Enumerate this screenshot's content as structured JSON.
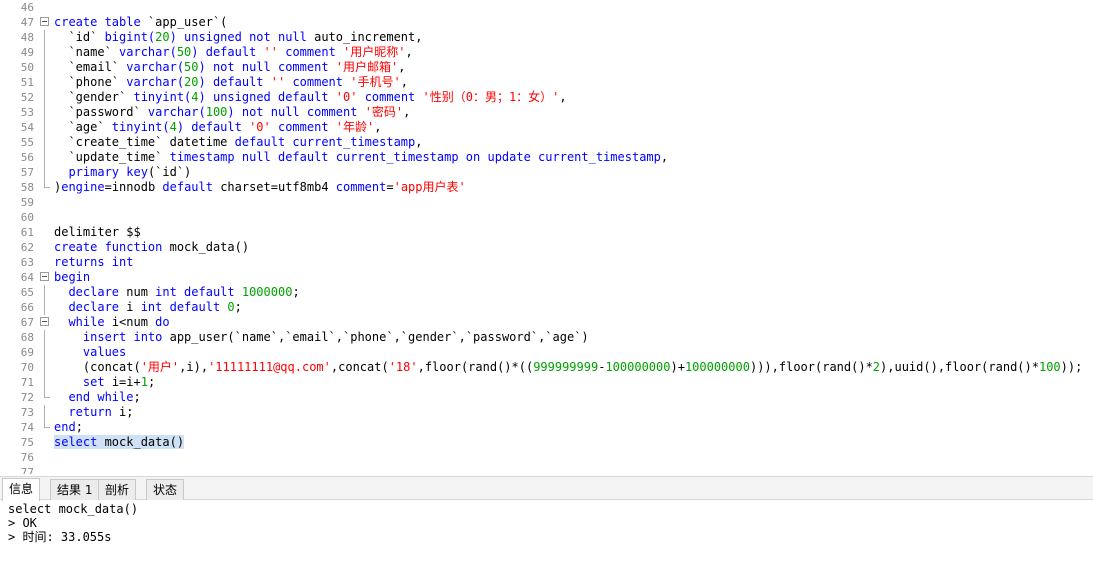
{
  "editor": {
    "lines": [
      {
        "n": "46",
        "segs": []
      },
      {
        "n": "47",
        "fold": "start",
        "segs": [
          [
            "kw",
            "create table "
          ],
          [
            "plain",
            "`app_user`("
          ]
        ]
      },
      {
        "n": "48",
        "fold": "line",
        "segs": [
          [
            "plain",
            "  `id` "
          ],
          [
            "kw",
            "bigint("
          ],
          [
            "num",
            "20"
          ],
          [
            "kw",
            ") unsigned not null "
          ],
          [
            "plain",
            "auto_increment,"
          ]
        ]
      },
      {
        "n": "49",
        "fold": "line",
        "segs": [
          [
            "plain",
            "  `name` "
          ],
          [
            "kw",
            "varchar("
          ],
          [
            "num",
            "50"
          ],
          [
            "kw",
            ") default "
          ],
          [
            "str",
            "'' "
          ],
          [
            "kw",
            "comment "
          ],
          [
            "str",
            "'用户昵称'"
          ],
          [
            "plain",
            ","
          ]
        ]
      },
      {
        "n": "50",
        "fold": "line",
        "segs": [
          [
            "plain",
            "  `email` "
          ],
          [
            "kw",
            "varchar("
          ],
          [
            "num",
            "50"
          ],
          [
            "kw",
            ") not null comment "
          ],
          [
            "str",
            "'用户邮箱'"
          ],
          [
            "plain",
            ","
          ]
        ]
      },
      {
        "n": "51",
        "fold": "line",
        "segs": [
          [
            "plain",
            "  `phone` "
          ],
          [
            "kw",
            "varchar("
          ],
          [
            "num",
            "20"
          ],
          [
            "kw",
            ") default "
          ],
          [
            "str",
            "'' "
          ],
          [
            "kw",
            "comment "
          ],
          [
            "str",
            "'手机号'"
          ],
          [
            "plain",
            ","
          ]
        ]
      },
      {
        "n": "52",
        "fold": "line",
        "segs": [
          [
            "plain",
            "  `gender` "
          ],
          [
            "kw",
            "tinyint("
          ],
          [
            "num",
            "4"
          ],
          [
            "kw",
            ") unsigned default "
          ],
          [
            "str",
            "'0' "
          ],
          [
            "kw",
            "comment "
          ],
          [
            "str",
            "'性别（0：男；1：女）'"
          ],
          [
            "plain",
            ","
          ]
        ]
      },
      {
        "n": "53",
        "fold": "line",
        "segs": [
          [
            "plain",
            "  `password` "
          ],
          [
            "kw",
            "varchar("
          ],
          [
            "num",
            "100"
          ],
          [
            "kw",
            ") not null comment "
          ],
          [
            "str",
            "'密码'"
          ],
          [
            "plain",
            ","
          ]
        ]
      },
      {
        "n": "54",
        "fold": "line",
        "segs": [
          [
            "plain",
            "  `age` "
          ],
          [
            "kw",
            "tinyint("
          ],
          [
            "num",
            "4"
          ],
          [
            "kw",
            ") default "
          ],
          [
            "str",
            "'0' "
          ],
          [
            "kw",
            "comment "
          ],
          [
            "str",
            "'年龄'"
          ],
          [
            "plain",
            ","
          ]
        ]
      },
      {
        "n": "55",
        "fold": "line",
        "segs": [
          [
            "plain",
            "  `create_time` datetime "
          ],
          [
            "kw",
            "default current_timestamp"
          ],
          [
            "plain",
            ","
          ]
        ]
      },
      {
        "n": "56",
        "fold": "line",
        "segs": [
          [
            "plain",
            "  `update_time` "
          ],
          [
            "kw",
            "timestamp null default current_timestamp on update current_timestamp"
          ],
          [
            "plain",
            ","
          ]
        ]
      },
      {
        "n": "57",
        "fold": "line",
        "segs": [
          [
            "plain",
            "  "
          ],
          [
            "kw",
            "primary key"
          ],
          [
            "plain",
            "(`id`)"
          ]
        ]
      },
      {
        "n": "58",
        "fold": "end",
        "segs": [
          [
            "plain",
            ")"
          ],
          [
            "kw",
            "engine"
          ],
          [
            "plain",
            "=innodb "
          ],
          [
            "kw",
            "default "
          ],
          [
            "plain",
            "charset=utf8mb4 "
          ],
          [
            "kw",
            "comment"
          ],
          [
            "plain",
            "="
          ],
          [
            "str",
            "'app用户表'"
          ]
        ]
      },
      {
        "n": "59",
        "segs": []
      },
      {
        "n": "60",
        "segs": []
      },
      {
        "n": "61",
        "segs": [
          [
            "plain",
            "delimiter $$"
          ]
        ]
      },
      {
        "n": "62",
        "segs": [
          [
            "kw",
            "create function "
          ],
          [
            "plain",
            "mock_data()"
          ]
        ]
      },
      {
        "n": "63",
        "segs": [
          [
            "kw",
            "returns int"
          ]
        ]
      },
      {
        "n": "64",
        "fold": "start",
        "segs": [
          [
            "kw",
            "begin"
          ]
        ]
      },
      {
        "n": "65",
        "fold": "line",
        "segs": [
          [
            "plain",
            "  "
          ],
          [
            "kw",
            "declare "
          ],
          [
            "plain",
            "num "
          ],
          [
            "kw",
            "int default "
          ],
          [
            "num",
            "1000000"
          ],
          [
            "plain",
            ";"
          ]
        ]
      },
      {
        "n": "66",
        "fold": "line",
        "segs": [
          [
            "plain",
            "  "
          ],
          [
            "kw",
            "declare "
          ],
          [
            "plain",
            "i "
          ],
          [
            "kw",
            "int default "
          ],
          [
            "num",
            "0"
          ],
          [
            "plain",
            ";"
          ]
        ]
      },
      {
        "n": "67",
        "fold": "start",
        "segs": [
          [
            "plain",
            "  "
          ],
          [
            "kw",
            "while "
          ],
          [
            "plain",
            "i<num "
          ],
          [
            "kw",
            "do"
          ]
        ]
      },
      {
        "n": "68",
        "fold": "line",
        "segs": [
          [
            "plain",
            "    "
          ],
          [
            "kw",
            "insert into "
          ],
          [
            "plain",
            "app_user(`name`,`email`,`phone`,`gender`,`password`,`age`)"
          ]
        ]
      },
      {
        "n": "69",
        "fold": "line",
        "segs": [
          [
            "plain",
            "    "
          ],
          [
            "kw",
            "values"
          ]
        ]
      },
      {
        "n": "70",
        "fold": "line",
        "segs": [
          [
            "plain",
            "    (concat("
          ],
          [
            "str",
            "'用户'"
          ],
          [
            "plain",
            ",i),"
          ],
          [
            "str",
            "'11111111@qq.com'"
          ],
          [
            "plain",
            ",concat("
          ],
          [
            "str",
            "'18'"
          ],
          [
            "plain",
            ",floor(rand()*(("
          ],
          [
            "num",
            "999999999"
          ],
          [
            "plain",
            "-"
          ],
          [
            "num",
            "100000000"
          ],
          [
            "plain",
            ")+"
          ],
          [
            "num",
            "100000000"
          ],
          [
            "plain",
            "))),floor(rand()*"
          ],
          [
            "num",
            "2"
          ],
          [
            "plain",
            "),uuid(),floor(rand()*"
          ],
          [
            "num",
            "100"
          ],
          [
            "plain",
            "));"
          ]
        ]
      },
      {
        "n": "71",
        "fold": "line",
        "segs": [
          [
            "plain",
            "    "
          ],
          [
            "kw",
            "set "
          ],
          [
            "plain",
            "i=i+"
          ],
          [
            "num",
            "1"
          ],
          [
            "plain",
            ";"
          ]
        ]
      },
      {
        "n": "72",
        "fold": "end",
        "segs": [
          [
            "plain",
            "  "
          ],
          [
            "kw",
            "end while"
          ],
          [
            "plain",
            ";"
          ]
        ]
      },
      {
        "n": "73",
        "fold": "line",
        "segs": [
          [
            "plain",
            "  "
          ],
          [
            "kw",
            "return "
          ],
          [
            "plain",
            "i;"
          ]
        ]
      },
      {
        "n": "74",
        "fold": "end",
        "segs": [
          [
            "kw",
            "end"
          ],
          [
            "plain",
            ";"
          ]
        ]
      },
      {
        "n": "75",
        "sel": true,
        "segs": [
          [
            "kw",
            "select "
          ],
          [
            "plain",
            "mock_data()"
          ]
        ]
      },
      {
        "n": "76",
        "segs": []
      },
      {
        "n": "77",
        "segs": []
      }
    ]
  },
  "tabs": [
    "信息",
    "结果 1",
    "剖析",
    "状态"
  ],
  "output": [
    "select mock_data()",
    "> OK",
    "> 时间: 33.055s"
  ]
}
